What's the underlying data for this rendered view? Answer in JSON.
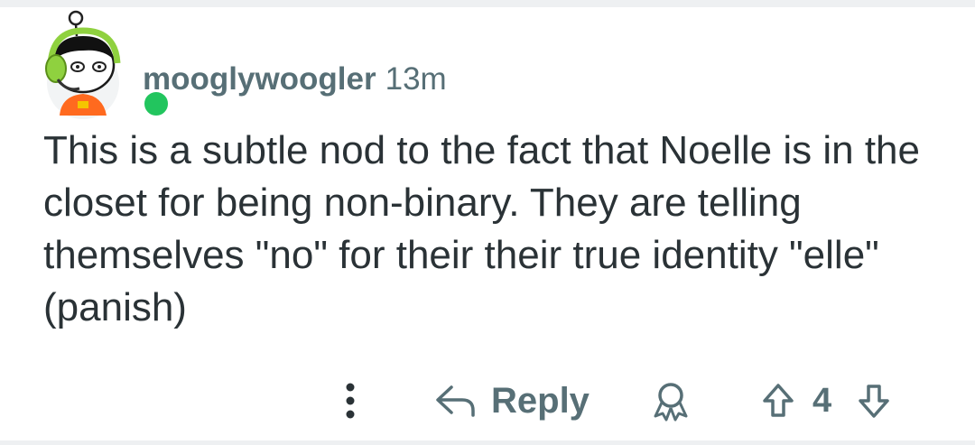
{
  "comment": {
    "username": "mooglywoogler",
    "timestamp": "13m",
    "body": "This is a subtle nod to the fact that Noelle is in the closet for being non-binary. They are telling themselves \"no\" for their their true identity \"elle\" (panish)",
    "online_status_color": "#22c55e"
  },
  "actions": {
    "more_icon": "vertical-ellipsis",
    "reply_icon": "reply-arrow",
    "reply_label": "Reply",
    "award_icon": "award-medal",
    "upvote_icon": "upvote-arrow",
    "vote_count": "4",
    "downvote_icon": "downvote-arrow"
  },
  "colors": {
    "meta_text": "#576f76",
    "body_text": "#2a3236",
    "avatar_headset": "#8fd13f",
    "avatar_shirt": "#ff6a1f"
  }
}
